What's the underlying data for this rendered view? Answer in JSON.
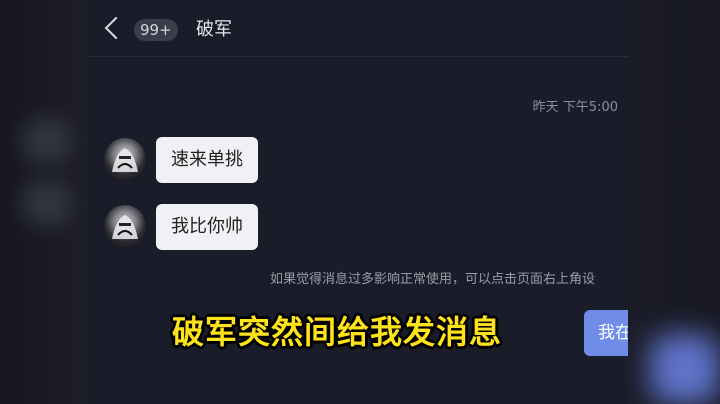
{
  "header": {
    "badge": "99+",
    "contact_name": "破军",
    "back_icon": "chevron-left-icon"
  },
  "chat": {
    "timestamp": "昨天 下午5:00",
    "messages": [
      {
        "from": "contact",
        "text": "速来单挑"
      },
      {
        "from": "contact",
        "text": "我比你帅"
      }
    ],
    "notice": "如果觉得消息过多影响正常使用，可以点击页面右上角设",
    "sent_preview": "我在"
  },
  "caption": "破军突然间给我发消息",
  "colors": {
    "caption": "#ffe31a",
    "sent_bubble": "#6f8ce8",
    "background": "#1b1c29"
  }
}
